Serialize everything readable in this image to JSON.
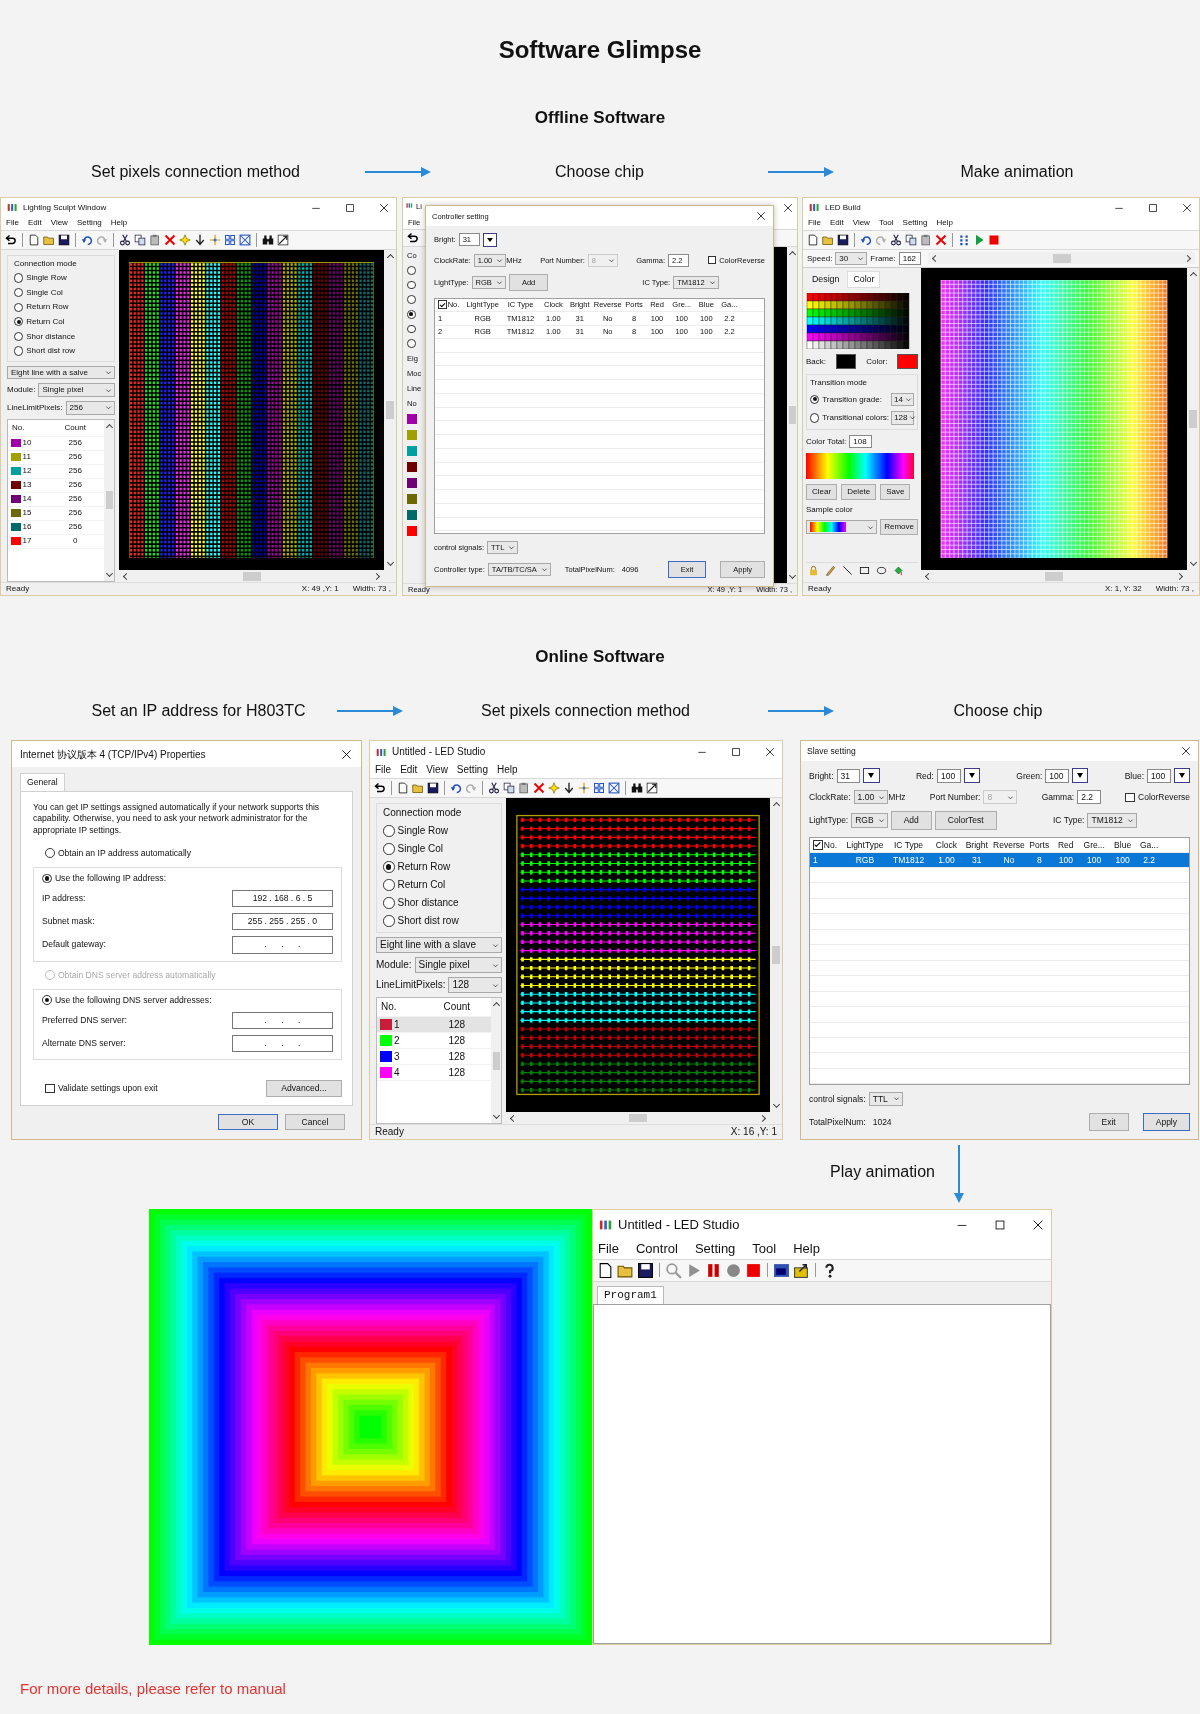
{
  "title": "Software Glimpse",
  "sections": [
    {
      "heading": "Offline Software",
      "steps": [
        "Set pixels connection method",
        "Choose chip",
        "Make animation"
      ],
      "windows": [
        {
          "kind": "mapper",
          "title": "Lighting Sculpt Window",
          "menu": [
            "File",
            "Edit",
            "View",
            "Setting",
            "Help"
          ],
          "group_label": "Connection mode",
          "modes": [
            {
              "label": "Single Row",
              "selected": false
            },
            {
              "label": "Single Col",
              "selected": false
            },
            {
              "label": "Return Row",
              "selected": false
            },
            {
              "label": "Return Col",
              "selected": true
            },
            {
              "label": "Shor distance",
              "selected": false
            },
            {
              "label": "Short dist row",
              "selected": false
            }
          ],
          "line_mode": "Eight line with a salve",
          "module_label": "Module:",
          "module": "Single pixel",
          "limit_label": "LineLimitPixels:",
          "limit": "256",
          "port_columns": [
            "No.",
            "Count"
          ],
          "ports": [
            {
              "no": "10",
              "count": "256",
              "color": "#a000a8",
              "selected": false
            },
            {
              "no": "11",
              "count": "256",
              "color": "#a0a000",
              "selected": false
            },
            {
              "no": "12",
              "count": "256",
              "color": "#00a0a0",
              "selected": false
            },
            {
              "no": "13",
              "count": "256",
              "color": "#700000",
              "selected": false
            },
            {
              "no": "14",
              "count": "256",
              "color": "#700078",
              "selected": false
            },
            {
              "no": "15",
              "count": "256",
              "color": "#6a6a00",
              "selected": false
            },
            {
              "no": "16",
              "count": "256",
              "color": "#006a6a",
              "selected": false
            },
            {
              "no": "17",
              "count": "0",
              "color": "#ff0000",
              "selected": false
            }
          ],
          "canvas": {
            "kind": "columns"
          },
          "status": [
            "Ready",
            "X: 49 ,Y: 1",
            "Width: 73 ,"
          ]
        },
        {
          "kind": "chip_dialog",
          "behind": {
            "title": "Li",
            "menu": [
              "File"
            ],
            "edge_labels": [
              "Co",
              "Eig",
              "Moc",
              "Line",
              "No"
            ],
            "modes": [
              {
                "selected": false
              },
              {
                "selected": false
              },
              {
                "selected": false
              },
              {
                "selected": true
              },
              {
                "selected": false
              },
              {
                "selected": false
              }
            ],
            "swatches": [
              {
                "color": "#a000a8"
              },
              {
                "color": "#a0a000"
              },
              {
                "color": "#00a0a0"
              },
              {
                "color": "#700000"
              },
              {
                "color": "#700078"
              },
              {
                "color": "#6a6a00"
              },
              {
                "color": "#006a6a"
              },
              {
                "color": "#ff0000"
              }
            ],
            "status": [
              "Ready",
              "X: 49 ,Y: 1",
              "Width: 73 ,"
            ]
          },
          "title": "Controller setting",
          "rows": [
            [
              {
                "kind": "spin",
                "label": "Bright:",
                "value": "31"
              }
            ],
            [
              {
                "kind": "select",
                "label": "ClockRate:",
                "value": "1.00",
                "suffix": "MHz",
                "disabled": false
              },
              {
                "kind": "select",
                "label": "Port Number:",
                "value": "8",
                "disabled": true
              },
              {
                "kind": "text",
                "label": "Gamma:",
                "value": "2.2"
              },
              {
                "kind": "check",
                "label": "ColorReverse",
                "checked": false
              }
            ],
            [
              {
                "kind": "select",
                "label": "LightType:",
                "value": "RGB",
                "disabled": false
              },
              {
                "kind": "button",
                "label": "Add",
                "focused": false
              },
              {
                "kind": "select",
                "label": "IC Type:",
                "value": "TM1812",
                "disabled": false
              }
            ]
          ],
          "table": {
            "columns": [
              "No.",
              "LightType",
              "IC Type",
              "Clock",
              "Bright",
              "Reverse",
              "Ports",
              "Red",
              "Gre...",
              "Blue",
              "Ga..."
            ],
            "header_checked": true,
            "rows": [
              {
                "cells": [
                  "1",
                  "RGB",
                  "TM1812",
                  "1.00",
                  "31",
                  "No",
                  "8",
                  "100",
                  "100",
                  "100",
                  "2.2"
                ],
                "selected": false
              },
              {
                "cells": [
                  "2",
                  "RGB",
                  "TM1812",
                  "1.00",
                  "31",
                  "No",
                  "8",
                  "100",
                  "100",
                  "100",
                  "2.2"
                ],
                "selected": false
              }
            ]
          },
          "footer_rows": [
            [
              {
                "kind": "select",
                "label": "control signals:",
                "value": "TTL",
                "disabled": false
              }
            ],
            [
              {
                "kind": "select",
                "label": "Controller type:",
                "value": "TA/TB/TC/SA",
                "disabled": false
              },
              {
                "kind": "info",
                "label": "TotalPixelNum:",
                "value": "4096"
              },
              {
                "kind": "button",
                "label": "Exit",
                "focused": true
              },
              {
                "kind": "button",
                "label": "Apply",
                "focused": false
              }
            ]
          ]
        },
        {
          "kind": "builder",
          "title": "LED Build",
          "menu": [
            "File",
            "Edit",
            "View",
            "Tool",
            "Setting",
            "Help"
          ],
          "speed_label": "Speed:",
          "speed": "30",
          "frame_label": "Frame:",
          "frame": "162",
          "tabs": [
            {
              "label": "Design",
              "selected": false
            },
            {
              "label": "Color",
              "selected": true
            }
          ],
          "swatches": [
            {
              "label": "Back:",
              "color": "#000000"
            },
            {
              "label": "Color:",
              "color": "#ff0000"
            }
          ],
          "group_label": "Transition mode",
          "transitions": [
            {
              "label": "Transition grade:",
              "value": "14",
              "selected": true
            },
            {
              "label": "Transitional colors:",
              "value": "128",
              "selected": false
            }
          ],
          "total_label": "Color Total:",
          "total": "108",
          "buttons": [
            "Clear",
            "Delete",
            "Save"
          ],
          "sample_label": "Sample color",
          "remove": "Remove",
          "status": [
            "Ready",
            "X: 1, Y: 32",
            "Width: 73 ,"
          ]
        }
      ]
    },
    {
      "heading": "Online Software",
      "steps": [
        "Set an IP address for H803TC",
        "Set pixels connection method",
        "Choose chip"
      ],
      "windows": [
        {
          "kind": "ip_dialog",
          "title": "Internet 协议版本 4 (TCP/IPv4) Properties",
          "tabs": [
            {
              "label": "General",
              "selected": true
            }
          ],
          "intro": "You can get IP settings assigned automatically if your network supports this capability. Otherwise, you need to ask your network administrator for the appropriate IP settings.",
          "ip_choice": [
            {
              "label": "Obtain an IP address automatically",
              "selected": false,
              "disabled": false
            },
            {
              "label": "Use the following IP address:",
              "selected": true,
              "disabled": false
            }
          ],
          "ip_fields": [
            {
              "label": "IP address:",
              "value": "192 . 168 . 6 . 5"
            },
            {
              "label": "Subnet mask:",
              "value": "255 . 255 . 255 . 0"
            },
            {
              "label": "Default gateway:",
              "value": ".      .      ."
            }
          ],
          "dns_choice": [
            {
              "label": "Obtain DNS server address automatically",
              "selected": false,
              "disabled": true
            },
            {
              "label": "Use the following DNS server addresses:",
              "selected": true,
              "disabled": false
            }
          ],
          "dns_fields": [
            {
              "label": "Preferred DNS server:",
              "value": ".      .      ."
            },
            {
              "label": "Alternate DNS server:",
              "value": ".      .      ."
            }
          ],
          "validate": {
            "label": "Validate settings upon exit",
            "checked": false
          },
          "advanced": "Advanced...",
          "buttons": [
            {
              "label": "OK",
              "focused": true
            },
            {
              "label": "Cancel",
              "focused": false
            }
          ]
        },
        {
          "kind": "mapper",
          "title": "Untitled - LED Studio",
          "menu": [
            "File",
            "Edit",
            "View",
            "Setting",
            "Help"
          ],
          "group_label": "Connection mode",
          "modes": [
            {
              "label": "Single Row",
              "selected": false
            },
            {
              "label": "Single Col",
              "selected": false
            },
            {
              "label": "Return Row",
              "selected": true
            },
            {
              "label": "Return Col",
              "selected": false
            },
            {
              "label": "Shor distance",
              "selected": false
            },
            {
              "label": "Short dist row",
              "selected": false
            }
          ],
          "line_mode": "Eight line with a slave",
          "module_label": "Module:",
          "module": "Single pixel",
          "limit_label": "LineLimitPixels:",
          "limit": "128",
          "port_columns": [
            "No.",
            "Count"
          ],
          "ports": [
            {
              "no": "1",
              "count": "128",
              "color": "#c81e3c",
              "selected": true
            },
            {
              "no": "2",
              "count": "128",
              "color": "#00ff00",
              "selected": false
            },
            {
              "no": "3",
              "count": "128",
              "color": "#0000ff",
              "selected": false
            },
            {
              "no": "4",
              "count": "128",
              "color": "#ff00ff",
              "selected": false
            }
          ],
          "canvas": {
            "kind": "rows"
          },
          "status": [
            "Ready",
            "X: 16 ,Y: 1"
          ]
        },
        {
          "kind": "chip_dialog",
          "title": "Slave setting",
          "rows": [
            [
              {
                "kind": "spin",
                "label": "Bright:",
                "value": "31"
              },
              {
                "kind": "spin",
                "label": "Red:",
                "value": "100"
              },
              {
                "kind": "spin",
                "label": "Green:",
                "value": "100"
              },
              {
                "kind": "spin",
                "label": "Blue:",
                "value": "100"
              }
            ],
            [
              {
                "kind": "select",
                "label": "ClockRate:",
                "value": "1.00",
                "suffix": "MHz",
                "disabled": false
              },
              {
                "kind": "select",
                "label": "Port Number:",
                "value": "8",
                "disabled": true
              },
              {
                "kind": "text",
                "label": "Gamma:",
                "value": "2.2"
              },
              {
                "kind": "check",
                "label": "ColorReverse",
                "checked": false
              }
            ],
            [
              {
                "kind": "select",
                "label": "LightType:",
                "value": "RGB",
                "disabled": false
              },
              {
                "kind": "button",
                "label": "Add",
                "focused": false
              },
              {
                "kind": "button",
                "label": "ColorTest",
                "focused": false
              },
              {
                "kind": "select",
                "label": "IC Type:",
                "value": "TM1812",
                "disabled": false
              }
            ]
          ],
          "table": {
            "columns": [
              "No.",
              "LightType",
              "IC Type",
              "Clock",
              "Bright",
              "Reverse",
              "Ports",
              "Red",
              "Gre...",
              "Blue",
              "Ga..."
            ],
            "header_checked": true,
            "rows": [
              {
                "cells": [
                  "1",
                  "RGB",
                  "TM1812",
                  "1.00",
                  "31",
                  "No",
                  "8",
                  "100",
                  "100",
                  "100",
                  "2.2"
                ],
                "selected": true
              }
            ]
          },
          "footer_rows": [
            [
              {
                "kind": "select",
                "label": "control signals:",
                "value": "TTL",
                "disabled": false
              }
            ],
            [
              {
                "kind": "info",
                "label": "TotalPixelNum:",
                "value": "1024"
              },
              {
                "kind": "button",
                "label": "Exit",
                "focused": false
              },
              {
                "kind": "button",
                "label": "Apply",
                "focused": true
              }
            ]
          ]
        }
      ]
    }
  ],
  "final": {
    "label": "Play animation",
    "window": {
      "kind": "player",
      "title": "Untitled - LED Studio",
      "menu": [
        "File",
        "Control",
        "Setting",
        "Tool",
        "Help"
      ],
      "tabs": [
        {
          "label": "Program1",
          "selected": true
        }
      ]
    }
  },
  "footer": "For more details, please refer to manual"
}
